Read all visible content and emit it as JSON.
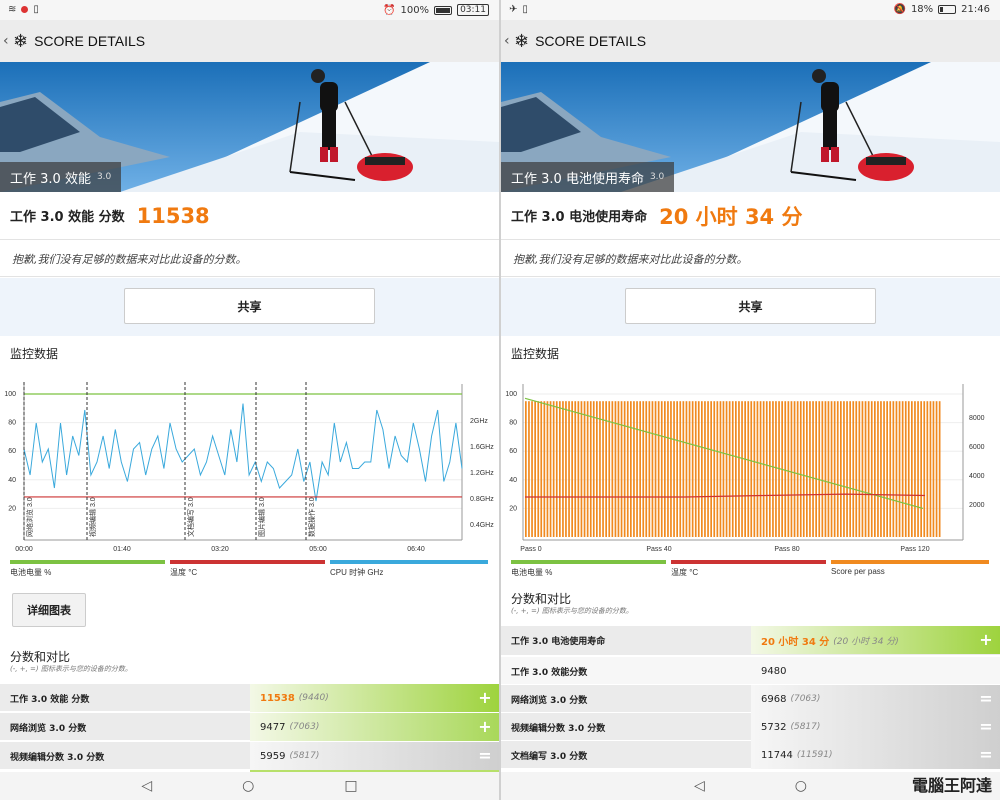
{
  "left": {
    "status": {
      "battery": "100%",
      "time": "03:11"
    },
    "title": "SCORE DETAILS",
    "hero": {
      "caption": "工作 3.0 效能",
      "version": "3.0"
    },
    "score": {
      "label": "工作 3.0 效能 分数",
      "value": "11538"
    },
    "sorry": "抱歉,我们没有足够的数据来对比此设备的分数。",
    "share_label": "共享",
    "monitor_title": "监控数据",
    "legend": [
      "电池电量 %",
      "温度 °C",
      "CPU 时钟 GHz"
    ],
    "detail_label": "详细图表",
    "compare_title": "分数和对比",
    "compare_sub": "(-, +, =) 图标表示与您的设备的分数。",
    "rows": [
      {
        "name": "工作 3.0 效能 分数",
        "value": "11538",
        "ref": "(9440)",
        "sign": "+"
      },
      {
        "name": "网络浏览 3.0 分数",
        "value": "9477",
        "ref": "(7063)",
        "sign": "+"
      },
      {
        "name": "视频编辑分数 3.0 分数",
        "value": "5959",
        "ref": "(5817)",
        "sign": "="
      }
    ]
  },
  "right": {
    "status": {
      "battery": "18%",
      "time": "21:46"
    },
    "title": "SCORE DETAILS",
    "hero": {
      "caption": "工作 3.0 电池使用寿命",
      "version": "3.0"
    },
    "score": {
      "label": "工作 3.0 电池使用寿命",
      "value": "20 小时 34 分"
    },
    "sorry": "抱歉,我们没有足够的数据来对比此设备的分数。",
    "share_label": "共享",
    "monitor_title": "监控数据",
    "legend": [
      "电池电量 %",
      "温度 °C",
      "Score per pass"
    ],
    "compare_title": "分数和对比",
    "compare_sub": "(-, +, =) 图标表示与您的设备的分数。",
    "rows": [
      {
        "name": "工作 3.0 电池使用寿命",
        "value": "20 小时 34 分",
        "ref": "(20 小时 34 分)",
        "sign": "+"
      },
      {
        "name": "工作 3.0 效能分数",
        "value": "9480",
        "ref": "",
        "sign": ""
      },
      {
        "name": "网络浏览 3.0 分数",
        "value": "6968",
        "ref": "(7063)",
        "sign": "="
      },
      {
        "name": "视频编辑分数 3.0 分数",
        "value": "5732",
        "ref": "(5817)",
        "sign": "="
      },
      {
        "name": "文档编写 3.0 分数",
        "value": "11744",
        "ref": "(11591)",
        "sign": "="
      }
    ]
  },
  "colors": {
    "accent": "#f07a10",
    "battery": "#7cc242",
    "temp": "#cc3333",
    "cpu": "#3aa9dc",
    "pass": "#f08a20"
  },
  "watermark": "電腦王阿達",
  "chart_data": [
    {
      "type": "line",
      "title": "",
      "xlabel": "",
      "x_ticks": [
        "00:00",
        "01:40",
        "03:20",
        "05:00",
        "06:40"
      ],
      "y_left_ticks": [
        20,
        40,
        60,
        80,
        100
      ],
      "y_right_ticks": [
        "0.4GHz",
        "0.8GHz",
        "1.2GHz",
        "1.6GHz",
        "2GHz"
      ],
      "ylim": [
        0,
        100
      ],
      "markers": [
        "网络浏览 3.0",
        "视频编辑 3.0",
        "文档编写 3.0",
        "图片编辑 3.0",
        "数据操作 3.0"
      ],
      "marker_x": [
        0,
        63,
        161,
        232,
        282
      ],
      "series": [
        {
          "name": "电池电量 %",
          "values": [
            100,
            100,
            100,
            100,
            100,
            100,
            100,
            100,
            100,
            100
          ]
        },
        {
          "name": "温度 °C",
          "values": [
            28,
            28,
            28,
            28,
            28,
            28,
            28,
            28,
            28,
            28
          ]
        },
        {
          "name": "CPU 时钟 GHz",
          "values": [
            1.2,
            0.8,
            1.6,
            1.0,
            1.2,
            0.6,
            1.6,
            0.8,
            1.4,
            1.1,
            1.8,
            0.8,
            1.0,
            1.4,
            0.9,
            1.5,
            1.0,
            0.7,
            1.2,
            1.3,
            0.8,
            1.2,
            1.4,
            0.9,
            1.6,
            1.2,
            1.0,
            1.1,
            1.2,
            0.8,
            1.0,
            1.4,
            1.1,
            0.8,
            1.5,
            1.0,
            1.9,
            0.8,
            1.0,
            0.7,
            1.0,
            0.9,
            0.6,
            0.7,
            0.8,
            1.2,
            0.7,
            1.0,
            0.4,
            1.0,
            0.8,
            1.6,
            1.0,
            1.3,
            0.9,
            0.9,
            1.0,
            1.0,
            1.8,
            1.5,
            0.9,
            1.4,
            1.1,
            1.0,
            1.6,
            1.2,
            0.7,
            1.4,
            1.8,
            0.7,
            1.0,
            1.6,
            0.9
          ]
        }
      ]
    },
    {
      "type": "bar",
      "title": "",
      "x_ticks": [
        "Pass 0",
        "Pass 40",
        "Pass 80",
        "Pass 120"
      ],
      "y_left_ticks": [
        20,
        40,
        60,
        80,
        100
      ],
      "y_right_ticks": [
        2000,
        4000,
        6000,
        8000
      ],
      "ylim": [
        0,
        100
      ],
      "passes": 136,
      "series": [
        {
          "name": "电池电量 %",
          "start": 97,
          "end": 20
        },
        {
          "name": "温度 °C",
          "values": [
            28,
            28,
            28,
            29,
            30,
            29
          ]
        },
        {
          "name": "Score per pass",
          "value_pct": 95
        }
      ]
    }
  ]
}
